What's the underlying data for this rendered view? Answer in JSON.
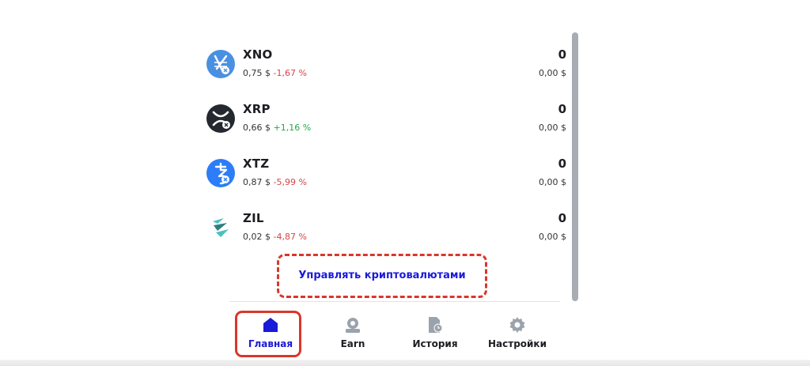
{
  "coins": [
    {
      "symbol": "XNO",
      "price": "0,75 $",
      "change": "-1,67 %",
      "change_dir": "negative",
      "amount": "0",
      "value": "0,00 $",
      "icon": "nano-icon",
      "icon_color": "#4a90e2"
    },
    {
      "symbol": "XRP",
      "price": "0,66 $",
      "change": "+1,16 %",
      "change_dir": "positive",
      "amount": "0",
      "value": "0,00 $",
      "icon": "xrp-icon",
      "icon_color": "#23292f"
    },
    {
      "symbol": "XTZ",
      "price": "0,87 $",
      "change": "-5,99 %",
      "change_dir": "negative",
      "amount": "0",
      "value": "0,00 $",
      "icon": "tezos-icon",
      "icon_color": "#2c7df7"
    },
    {
      "symbol": "ZIL",
      "price": "0,02 $",
      "change": "-4,87 %",
      "change_dir": "negative",
      "amount": "0",
      "value": "0,00 $",
      "icon": "zilliqa-icon",
      "icon_color": "#49c1bf"
    }
  ],
  "manage_link": "Управлять криптовалютами",
  "nav": {
    "items": [
      {
        "label": "Главная",
        "icon": "home-icon",
        "active": true
      },
      {
        "label": "Earn",
        "icon": "earn-icon",
        "active": false
      },
      {
        "label": "История",
        "icon": "history-icon",
        "active": false
      },
      {
        "label": "Настройки",
        "icon": "settings-icon",
        "active": false
      }
    ]
  },
  "colors": {
    "accent": "#1a1ad9",
    "negative": "#d64545",
    "positive": "#28a745",
    "highlight": "#d9372b",
    "inactive_icon": "#9aa3ad"
  }
}
